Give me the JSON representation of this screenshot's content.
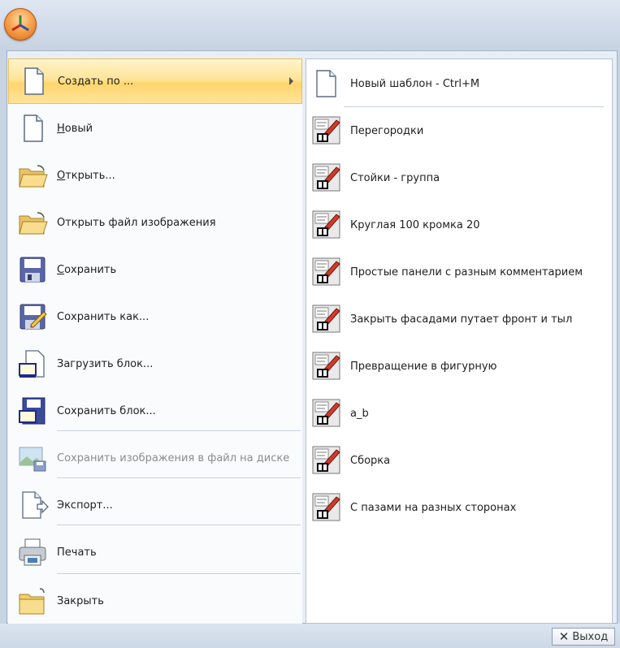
{
  "menu": {
    "items": [
      {
        "label": "Создать по ...",
        "icon": "new-document-icon",
        "active": true,
        "has_submenu": true
      },
      {
        "label": "Новый",
        "icon": "document-icon"
      },
      {
        "label": "Открыть...",
        "icon": "open-folder-icon"
      },
      {
        "label": "Открыть файл изображения",
        "icon": "open-folder-icon"
      },
      {
        "label": "Сохранить",
        "icon": "floppy-disk-icon"
      },
      {
        "label": "Сохранить как...",
        "icon": "save-as-icon"
      },
      {
        "label": "Загрузить блок...",
        "icon": "load-block-icon"
      },
      {
        "label": "Сохранить блок...",
        "icon": "save-block-icon"
      },
      {
        "label": "Сохранить изображения в файл на диске",
        "icon": "save-image-icon",
        "disabled": true
      },
      {
        "label": "Экспорт...",
        "icon": "export-icon"
      },
      {
        "label": "Печать",
        "icon": "printer-icon"
      },
      {
        "label": "Закрыть",
        "icon": "close-folder-icon"
      }
    ]
  },
  "submenu": {
    "header": "Новый шаблон - Ctrl+M",
    "items": [
      "Перегородки",
      "Стойки - группа",
      "Круглая 100 кромка 20",
      "Простые панели с разным комментарием",
      "Закрыть фасадами путает фронт и тыл",
      "Превращение в фигурную",
      "a_b",
      "Сборка",
      "С пазами на разных сторонах"
    ]
  },
  "footer": {
    "exit_label": "Выход"
  },
  "colors": {
    "highlight": "#ffe59a",
    "accent": "#f6a14a"
  }
}
